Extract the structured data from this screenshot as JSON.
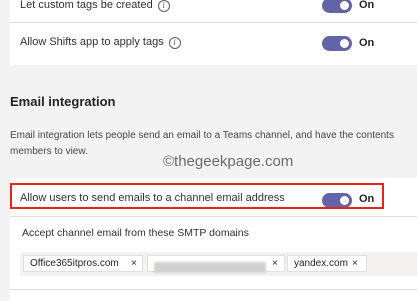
{
  "settings": {
    "custom_tags": {
      "label": "Let custom tags be created",
      "info_icon": "info-icon",
      "state": "On"
    },
    "shifts_tags": {
      "label": "Allow Shifts app to apply tags",
      "info_icon": "info-icon",
      "state": "On"
    }
  },
  "email_integration": {
    "title": "Email integration",
    "description_line1": "Email integration lets people send an email to a Teams channel, and have the contents",
    "description_line2": "members to view.",
    "allow_emails": {
      "label": "Allow users to send emails to a channel email address",
      "state": "On"
    },
    "smtp": {
      "label": "Accept channel email from these SMTP domains",
      "domains": [
        "Office365itpros.com",
        "",
        "yandex.com"
      ],
      "remove_glyph": "×"
    }
  },
  "watermark": "©thegeekpage.com",
  "colors": {
    "toggle_on": "#6264a7",
    "highlight": "#e2261c",
    "background": "#f3f3f3"
  }
}
